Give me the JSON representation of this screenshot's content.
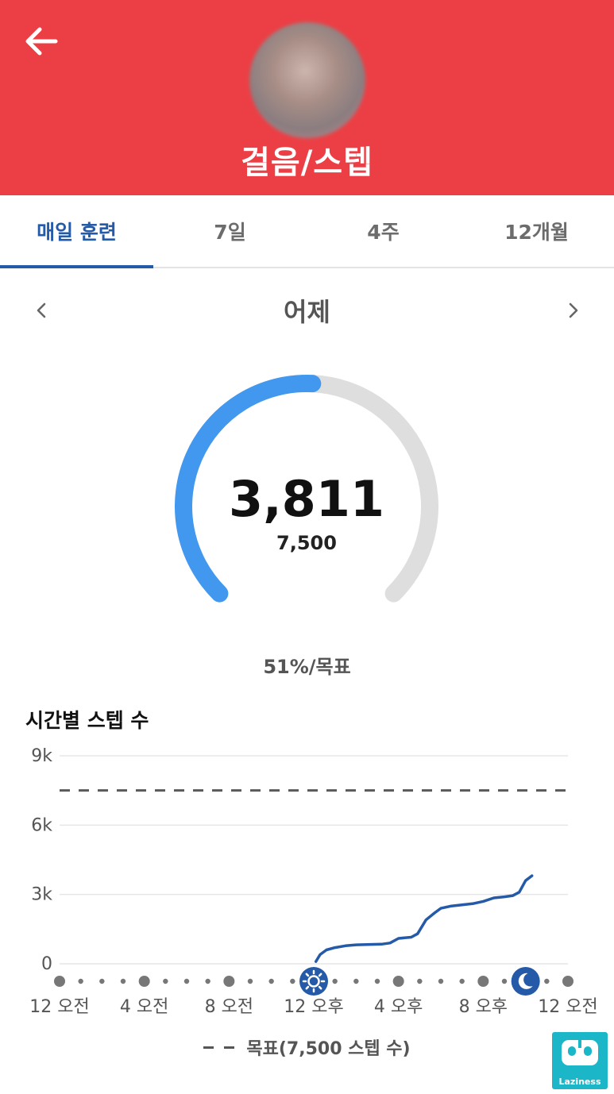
{
  "header": {
    "title": "걸음/스텝",
    "back_icon": "arrow-left-icon",
    "color": "#ec3f45"
  },
  "tabs": [
    {
      "label": "매일 훈련",
      "active": true
    },
    {
      "label": "7일",
      "active": false
    },
    {
      "label": "4주",
      "active": false
    },
    {
      "label": "12개월",
      "active": false
    }
  ],
  "date_nav": {
    "label": "어제",
    "prev_icon": "chevron-left-icon",
    "next_icon": "chevron-right-icon"
  },
  "summary": {
    "steps": "3,811",
    "goal": "7,500",
    "percent_text": "51%/목표",
    "progress_fraction": 0.51,
    "progress_color": "#4198ee",
    "track_color": "#dedede"
  },
  "chart_section": {
    "title": "시간별 스텝 수"
  },
  "chart_data": {
    "type": "line",
    "ytick_labels": [
      "9k",
      "6k",
      "3k",
      "0"
    ],
    "ylim": [
      0,
      9000
    ],
    "xlim": [
      0,
      24
    ],
    "xtick_labels": [
      "12 오전",
      "4 오전",
      "8 오전",
      "12 오후",
      "4 오후",
      "8 오후",
      "12 오전"
    ],
    "goal_line": 7500,
    "legend": "목표(7,500 스텝 수)",
    "series": [
      {
        "color": "#245aa8",
        "x": [
          12.1,
          12.3,
          12.6,
          13.0,
          13.5,
          14.0,
          14.5,
          15.2,
          15.6,
          16.0,
          16.6,
          16.9,
          17.3,
          17.7,
          18.0,
          18.5,
          19.0,
          19.5,
          20.0,
          20.5,
          21.0,
          21.4,
          21.7,
          22.0,
          22.3
        ],
        "y": [
          100,
          400,
          600,
          700,
          780,
          820,
          830,
          850,
          900,
          1100,
          1150,
          1300,
          1900,
          2200,
          2400,
          2500,
          2550,
          2600,
          2700,
          2850,
          2900,
          2950,
          3100,
          3600,
          3811
        ]
      }
    ],
    "markers": {
      "sunrise_hour": 12,
      "sunset_hour": 22,
      "sun_icon": "sun-icon",
      "moon_icon": "moon-icon"
    }
  },
  "watermark": {
    "label": "Laziness"
  }
}
